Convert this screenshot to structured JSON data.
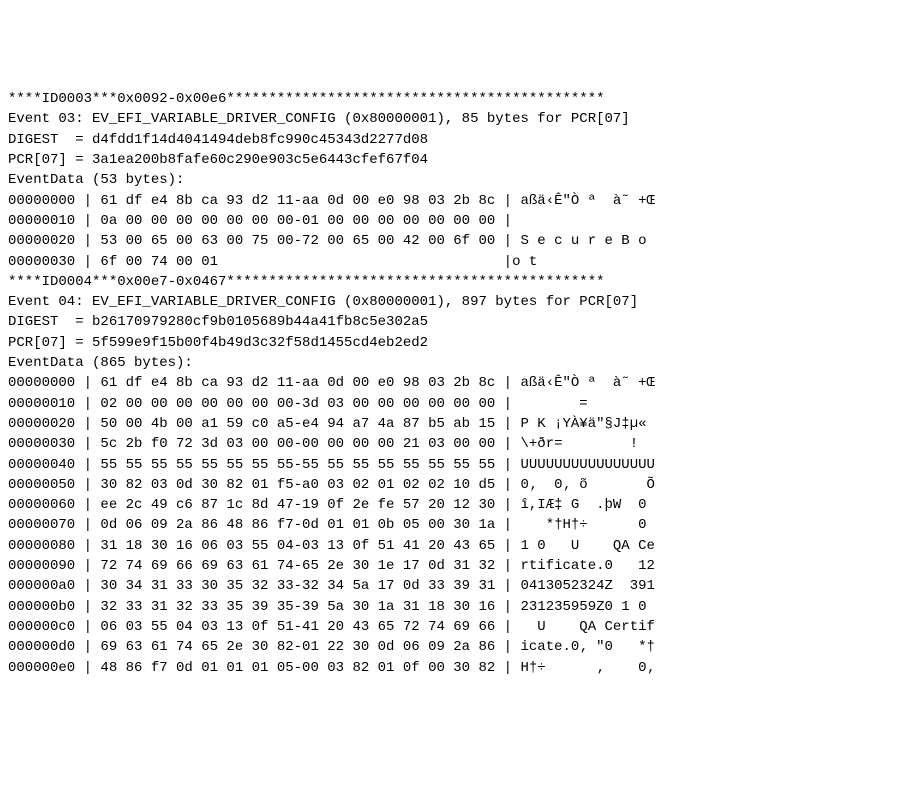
{
  "lines": [
    "****ID0003***0x0092-0x00e6*********************************************",
    "Event 03: EV_EFI_VARIABLE_DRIVER_CONFIG (0x80000001), 85 bytes for PCR[07]",
    "DIGEST  = d4fdd1f14d4041494deb8fc990c45343d2277d08",
    "PCR[07] = 3a1ea200b8fafe60c290e903c5e6443cfef67f04",
    "EventData (53 bytes):",
    "00000000 | 61 df e4 8b ca 93 d2 11-aa 0d 00 e0 98 03 2b 8c | aßä‹Ê\"Ò ª  à˜ +Œ",
    "00000010 | 0a 00 00 00 00 00 00 00-01 00 00 00 00 00 00 00 |",
    "00000020 | 53 00 65 00 63 00 75 00-72 00 65 00 42 00 6f 00 | S e c u r e B o",
    "00000030 | 6f 00 74 00 01                                  |o t",
    "****ID0004***0x00e7-0x0467*********************************************",
    "Event 04: EV_EFI_VARIABLE_DRIVER_CONFIG (0x80000001), 897 bytes for PCR[07]",
    "DIGEST  = b26170979280cf9b0105689b44a41fb8c5e302a5",
    "PCR[07] = 5f599e9f15b00f4b49d3c32f58d1455cd4eb2ed2",
    "EventData (865 bytes):",
    "00000000 | 61 df e4 8b ca 93 d2 11-aa 0d 00 e0 98 03 2b 8c | aßä‹Ê\"Ò ª  à˜ +Œ",
    "00000010 | 02 00 00 00 00 00 00 00-3d 03 00 00 00 00 00 00 |        =",
    "00000020 | 50 00 4b 00 a1 59 c0 a5-e4 94 a7 4a 87 b5 ab 15 | P K ¡YÀ¥ä\"§J‡µ«",
    "00000030 | 5c 2b f0 72 3d 03 00 00-00 00 00 00 21 03 00 00 | \\+ðr=        !",
    "00000040 | 55 55 55 55 55 55 55 55-55 55 55 55 55 55 55 55 | UUUUUUUUUUUUUUUU",
    "00000050 | 30 82 03 0d 30 82 01 f5-a0 03 02 01 02 02 10 d5 | 0‚  0‚ õ       Õ",
    "00000060 | ee 2c 49 c6 87 1c 8d 47-19 0f 2e fe 57 20 12 30 | î,IÆ‡ G  .þW  0",
    "00000070 | 0d 06 09 2a 86 48 86 f7-0d 01 01 0b 05 00 30 1a |    *†H†÷      0",
    "00000080 | 31 18 30 16 06 03 55 04-03 13 0f 51 41 20 43 65 | 1 0   U    QA Ce",
    "00000090 | 72 74 69 66 69 63 61 74-65 2e 30 1e 17 0d 31 32 | rtificate.0   12",
    "000000a0 | 30 34 31 33 30 35 32 33-32 34 5a 17 0d 33 39 31 | 0413052324Z  391",
    "000000b0 | 32 33 31 32 33 35 39 35-39 5a 30 1a 31 18 30 16 | 231235959Z0 1 0",
    "000000c0 | 06 03 55 04 03 13 0f 51-41 20 43 65 72 74 69 66 |   U    QA Certif",
    "000000d0 | 69 63 61 74 65 2e 30 82-01 22 30 0d 06 09 2a 86 | icate.0‚ \"0   *†",
    "000000e0 | 48 86 f7 0d 01 01 01 05-00 03 82 01 0f 00 30 82 | H†÷      ‚    0‚"
  ]
}
